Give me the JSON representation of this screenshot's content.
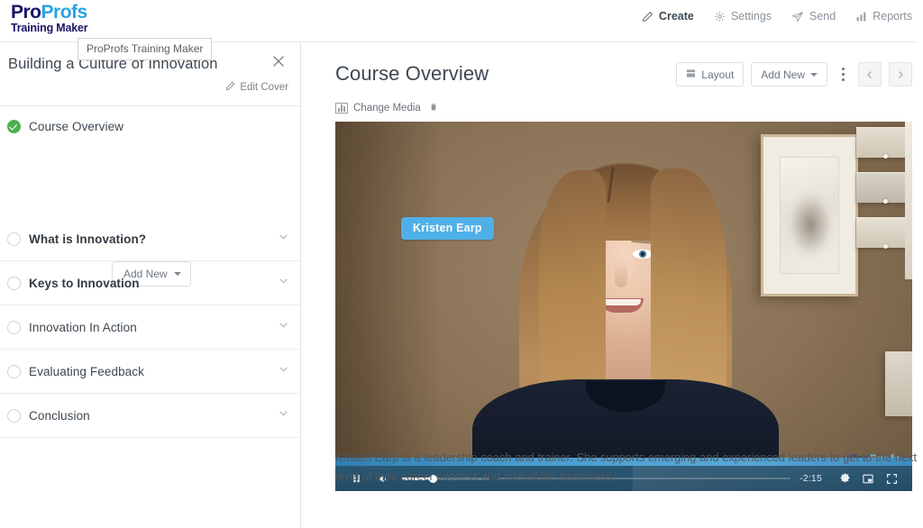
{
  "brand": {
    "logo_part1": "Pro",
    "logo_part2": "Profs",
    "logo_sub": "Training Maker",
    "color_dark": "#1b1464",
    "color_light": "#29a3e3"
  },
  "tooltip": {
    "text": "ProProfs Training Maker"
  },
  "topnav": {
    "items": [
      {
        "label": "Create",
        "icon": "pencil-icon",
        "active": true
      },
      {
        "label": "Settings",
        "icon": "gear-icon",
        "active": false
      },
      {
        "label": "Send",
        "icon": "paper-plane-icon",
        "active": false
      },
      {
        "label": "Reports",
        "icon": "bar-chart-icon",
        "active": false
      }
    ]
  },
  "sidebar": {
    "course_title": "Building a Culture of Innovation",
    "close_label": "×",
    "edit_cover_label": "Edit Cover",
    "add_new_label": "Add New",
    "items": [
      {
        "label": "Course Overview",
        "state": "done",
        "chevron": false
      },
      {
        "label": "What is Innovation?",
        "state": "pending",
        "chevron": true
      },
      {
        "label": "Keys to Innovation",
        "state": "pending",
        "chevron": true
      },
      {
        "label": "Innovation In Action",
        "state": "pending",
        "chevron": true
      },
      {
        "label": "Evaluating Feedback",
        "state": "pending",
        "chevron": true
      },
      {
        "label": "Conclusion",
        "state": "pending",
        "chevron": true
      }
    ]
  },
  "main": {
    "page_title": "Course Overview",
    "layout_label": "Layout",
    "add_new_label": "Add New",
    "change_media_label": "Change Media",
    "prev_label": "‹",
    "next_label": "›",
    "body_text": "Kristen Earp is a leadership coach and trainer. She supports emerging and experienced leaders to get to the next level of their career success and overall life happiness."
  },
  "video": {
    "name_badge": "Kristen Earp",
    "watermark_part1": "Pro",
    "watermark_part2": "Profs",
    "time_remaining": "-2:15",
    "controls": [
      {
        "name": "pause-button",
        "label": "pause"
      },
      {
        "name": "volume-button",
        "label": "volume"
      },
      {
        "name": "settings-button",
        "label": "settings"
      },
      {
        "name": "pip-button",
        "label": "picture-in-picture"
      },
      {
        "name": "fullscreen-button",
        "label": "fullscreen"
      }
    ],
    "accent_color": "#4fb0e8",
    "bar_color": "#24506a"
  }
}
